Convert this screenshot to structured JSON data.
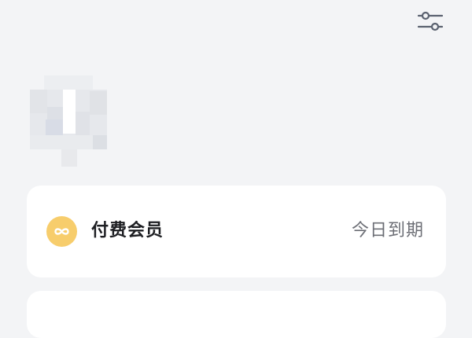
{
  "header": {
    "settings_icon": "sliders-icon"
  },
  "profile": {
    "avatar_icon": "blurred-avatar"
  },
  "membership": {
    "icon": "infinity-icon",
    "title": "付费会员",
    "status": "今日到期",
    "icon_color": "#f7cd6c"
  },
  "colors": {
    "background": "#f3f4f6",
    "card": "#ffffff",
    "title": "#1d1e22",
    "secondary": "#6d6f76",
    "icon_stroke": "#5b6270"
  }
}
